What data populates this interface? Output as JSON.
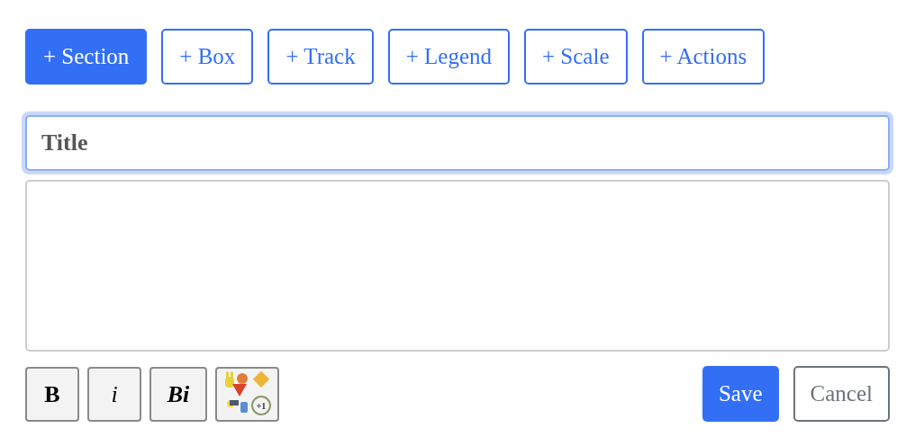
{
  "insert_buttons": [
    {
      "label": "+ Section",
      "selected": true
    },
    {
      "label": "+ Box",
      "selected": false
    },
    {
      "label": "+ Track",
      "selected": false
    },
    {
      "label": "+ Legend",
      "selected": false
    },
    {
      "label": "+ Scale",
      "selected": false
    },
    {
      "label": "+ Actions",
      "selected": false
    }
  ],
  "title_field": {
    "placeholder": "Title",
    "focused": true
  },
  "format_buttons": [
    {
      "kind": "bold",
      "label": "B"
    },
    {
      "kind": "italic",
      "label": "i"
    },
    {
      "kind": "bold-italic",
      "label": "Bi"
    },
    {
      "kind": "icons",
      "badge": "+1"
    }
  ],
  "save_button": "Save",
  "cancel_button": "Cancel"
}
